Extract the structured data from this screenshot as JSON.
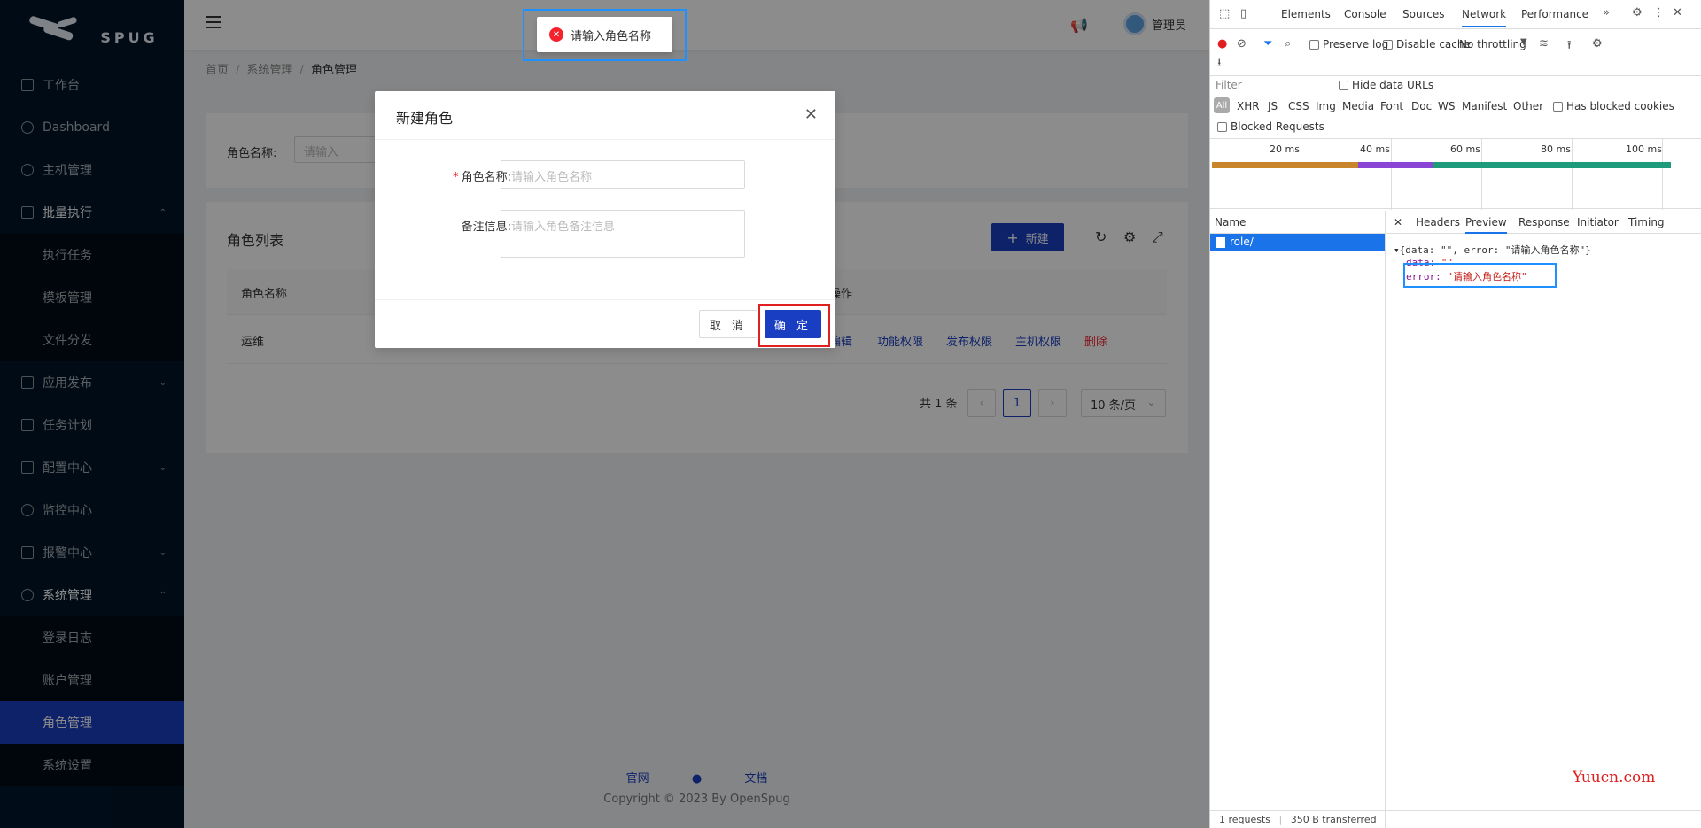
{
  "app": {
    "logo_text": "SPUG",
    "sidebar": {
      "items": [
        {
          "label": "工作台",
          "icon": "desktop-icon"
        },
        {
          "label": "Dashboard",
          "icon": "dashboard-icon"
        },
        {
          "label": "主机管理",
          "icon": "cloud-server-icon"
        },
        {
          "label": "批量执行",
          "icon": "code-icon",
          "open": true,
          "children": [
            "执行任务",
            "模板管理",
            "文件分发"
          ]
        },
        {
          "label": "应用发布",
          "icon": "flag-icon"
        },
        {
          "label": "任务计划",
          "icon": "schedule-icon"
        },
        {
          "label": "配置中心",
          "icon": "deployment-icon"
        },
        {
          "label": "监控中心",
          "icon": "monitor-icon"
        },
        {
          "label": "报警中心",
          "icon": "alert-icon"
        },
        {
          "label": "系统管理",
          "icon": "setting-icon",
          "open": true,
          "children": [
            "登录日志",
            "账户管理",
            "角色管理",
            "系统设置"
          ]
        }
      ],
      "active_item": "角色管理"
    },
    "header": {
      "username": "管理员"
    },
    "breadcrumb": [
      "首页",
      "系统管理",
      "角色管理"
    ],
    "filter": {
      "label": "角色名称:",
      "placeholder": "请输入"
    },
    "list": {
      "title": "角色列表",
      "new_button": "新建",
      "columns": [
        "角色名称",
        "操作"
      ],
      "rows": [
        {
          "name": "运维",
          "ops": [
            "编辑",
            "功能权限",
            "发布权限",
            "主机权限",
            "删除"
          ]
        }
      ],
      "pagination": {
        "total": "共 1 条",
        "page": "1",
        "page_size": "10 条/页"
      }
    },
    "footer": {
      "links": [
        "官网",
        "文档"
      ],
      "copyright": "Copyright © 2023 By OpenSpug"
    },
    "toast": {
      "message": "请输入角色名称"
    },
    "modal": {
      "title": "新建角色",
      "fields": [
        {
          "label": "角色名称:",
          "placeholder": "请输入角色名称",
          "required": true
        },
        {
          "label": "备注信息:",
          "placeholder": "请输入角色备注信息",
          "required": false
        }
      ],
      "cancel": "取 消",
      "ok": "确 定"
    }
  },
  "devtools": {
    "tabs": [
      "Elements",
      "Console",
      "Sources",
      "Network",
      "Performance"
    ],
    "active_tab": "Network",
    "toolbar": {
      "preserve_log": "Preserve log",
      "disable_cache": "Disable cache",
      "throttling": "No throttling"
    },
    "filter_placeholder": "Filter",
    "hide_data_urls": "Hide data URLs",
    "types": [
      "All",
      "XHR",
      "JS",
      "CSS",
      "Img",
      "Media",
      "Font",
      "Doc",
      "WS",
      "Manifest",
      "Other"
    ],
    "has_blocked_cookies": "Has blocked cookies",
    "blocked_requests": "Blocked Requests",
    "timeline_ticks": [
      "20 ms",
      "40 ms",
      "60 ms",
      "80 ms",
      "100 ms"
    ],
    "name_header": "Name",
    "request_name": "role/",
    "detail_tabs": [
      "Headers",
      "Preview",
      "Response",
      "Initiator",
      "Timing"
    ],
    "active_detail_tab": "Preview",
    "preview": {
      "summary": "{data: \"\", error: \"请输入角色名称\"}",
      "data_key": "data:",
      "data_val": "\"\"",
      "error_key": "error:",
      "error_val": "\"请输入角色名称\""
    },
    "status": {
      "requests": "1 requests",
      "transferred": "350 B transferred"
    }
  },
  "watermark": "Yuucn.com"
}
